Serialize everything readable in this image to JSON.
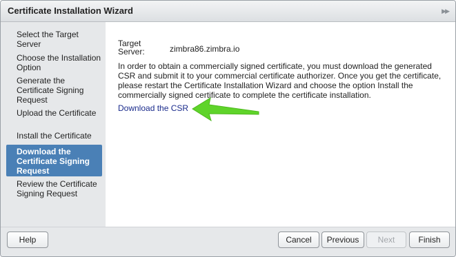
{
  "dialog": {
    "title": "Certificate Installation Wizard",
    "collapse_icon": "double-chevron-right-icon"
  },
  "sidebar": {
    "steps": [
      {
        "label": "Select the Target Server",
        "active": false
      },
      {
        "label": "Choose the Installation Option",
        "active": false
      },
      {
        "label": "Generate the Certificate Signing Request",
        "active": false
      },
      {
        "label": "Upload the Certificate",
        "active": false
      },
      {
        "label": "Install the Certificate",
        "active": false
      },
      {
        "label": "Download the Certificate Signing Request",
        "active": true
      },
      {
        "label": "Review the Certificate Signing Request",
        "active": false
      }
    ]
  },
  "content": {
    "target_server_label": "Target Server:",
    "target_server_value": "zimbra86.zimbra.io",
    "instructions": "In order to obtain a commercially signed certificate, you must download the generated CSR and submit it to your commercial certificate authorizer. Once you get the certificate, please restart the Certificate Installation Wizard and choose the option Install the commercially signed certificate to complete the certificate installation.",
    "download_link": "Download the CSR",
    "annotation_arrow_icon": "green-arrow-icon"
  },
  "footer": {
    "help": "Help",
    "cancel": "Cancel",
    "previous": "Previous",
    "next": "Next",
    "finish": "Finish"
  },
  "colors": {
    "active_step": "#4a80b6",
    "link": "#1a2b8c",
    "arrow": "#5fd42a"
  }
}
